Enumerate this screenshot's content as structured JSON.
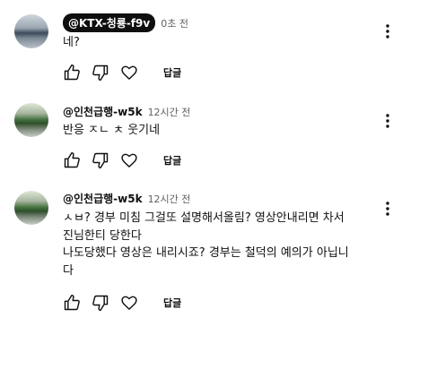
{
  "comments": [
    {
      "author": "@KTX-청룡-f9v",
      "time": "0초 전",
      "text": "네?",
      "reply_label": "답글",
      "author_chip": true
    },
    {
      "author": "@인천급행-w5k",
      "time": "12시간 전",
      "text": "반응 ㅈㄴ ㅊ 웃기네",
      "reply_label": "답글",
      "author_chip": false
    },
    {
      "author": "@인천급행-w5k",
      "time": "12시간 전",
      "text_lines": [
        "ㅅㅂ? 경부 미침 그걸또 설명해서올림? 영상안내리면 차서",
        "진님한티 당한다",
        "나도당했다 영상은 내리시죠? 경부는 철덕의 예의가 아닙니",
        "다"
      ],
      "reply_label": "답글",
      "author_chip": false
    }
  ],
  "icons": [
    "like-icon",
    "dislike-icon",
    "heart-icon",
    "more-vert-icon"
  ]
}
